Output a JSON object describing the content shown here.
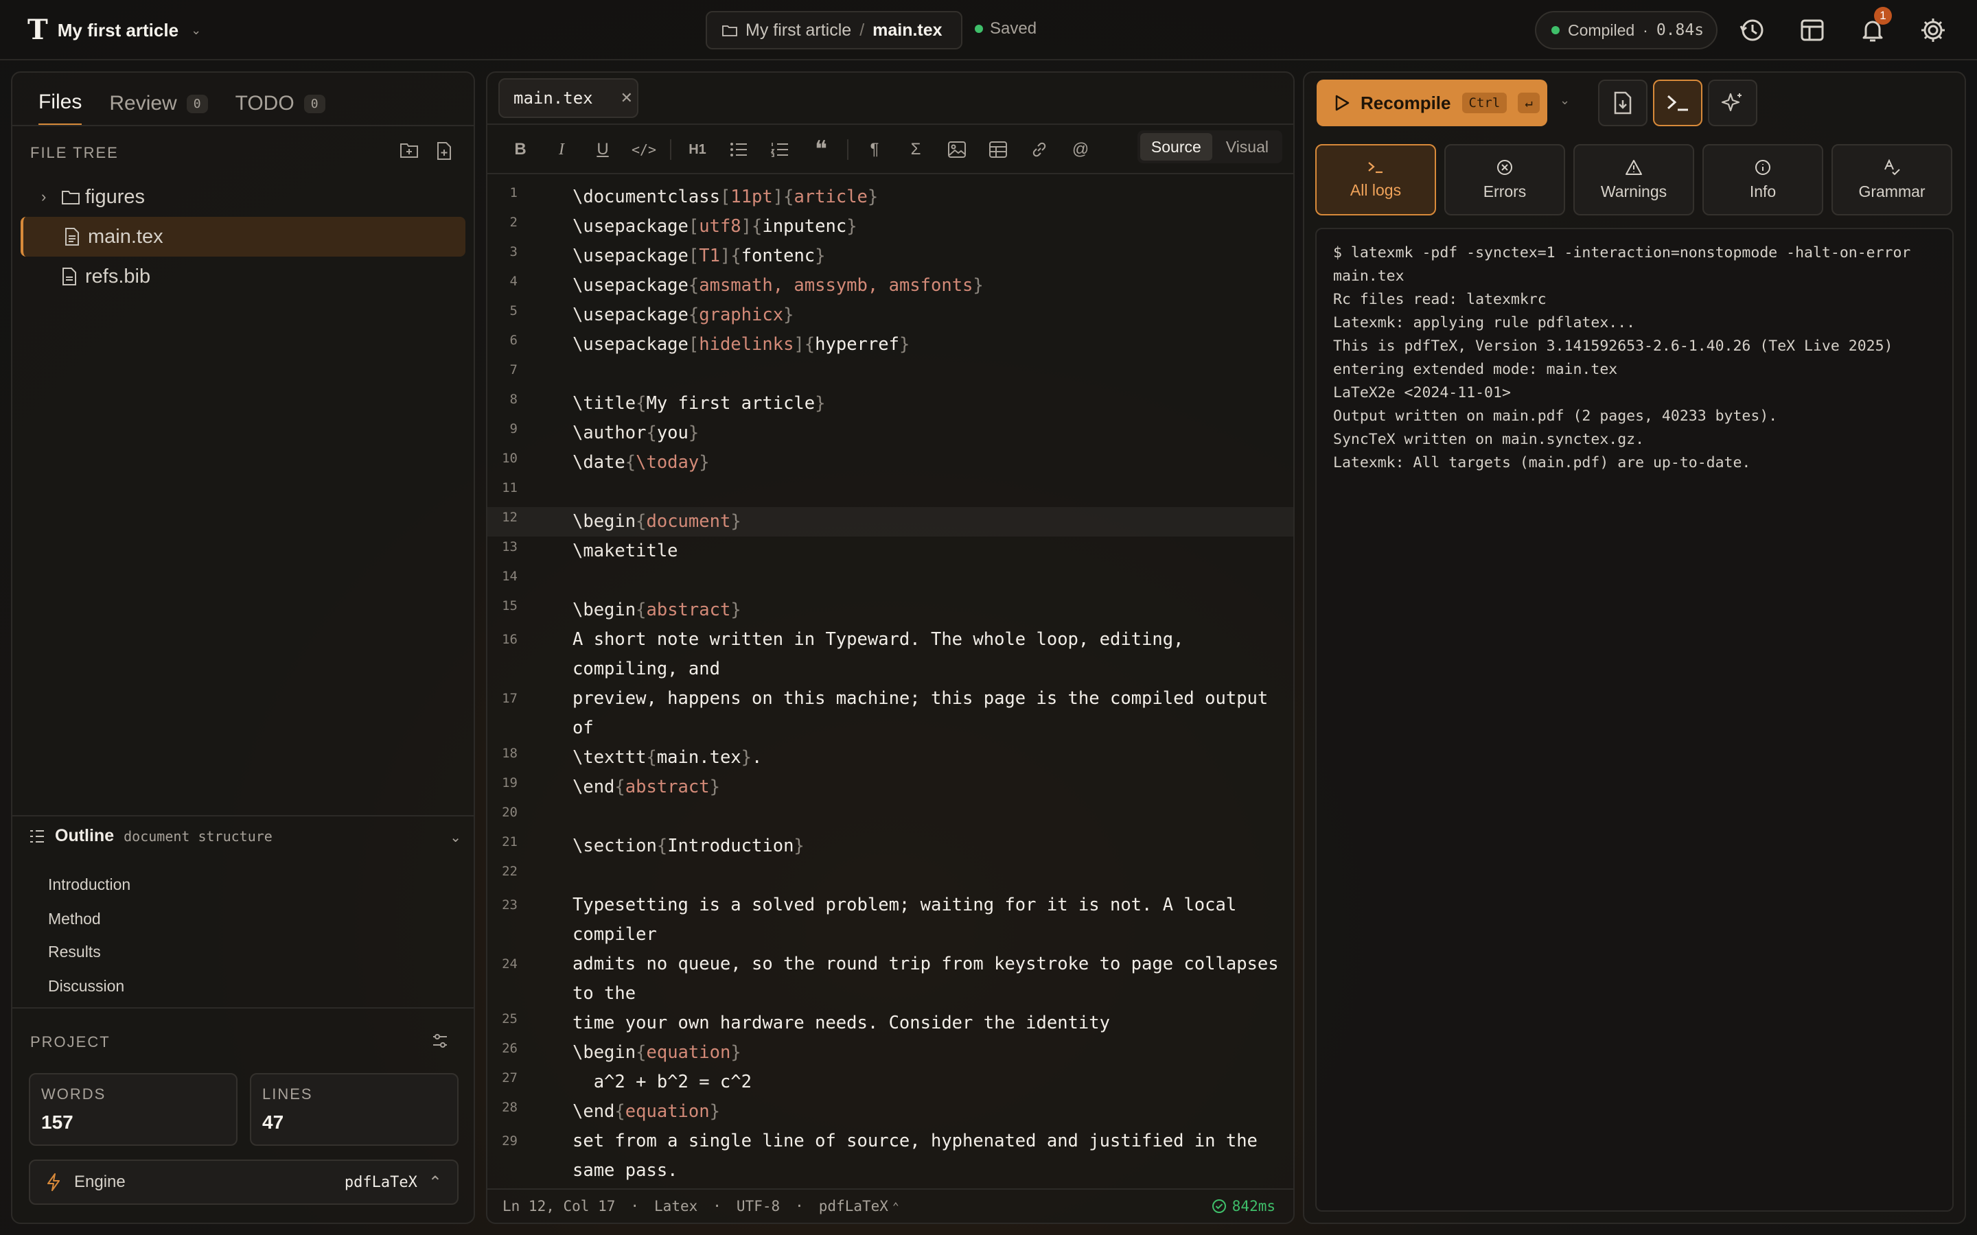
{
  "app": {
    "project_title": "My first article"
  },
  "breadcrumb": {
    "project": "My first article",
    "separator": "/",
    "file": "main.tex",
    "saved_label": "Saved"
  },
  "compile_status": {
    "label": "Compiled",
    "separator": "·",
    "time": "0.84s"
  },
  "notifications": {
    "count": "1"
  },
  "sidebar": {
    "tabs": [
      {
        "label": "Files",
        "count": ""
      },
      {
        "label": "Review",
        "count": "0"
      },
      {
        "label": "TODO",
        "count": "0"
      }
    ],
    "file_tree_label": "FILE TREE",
    "tree": [
      {
        "label": "figures",
        "type": "folder"
      },
      {
        "label": "main.tex",
        "type": "file",
        "selected": true
      },
      {
        "label": "refs.bib",
        "type": "file"
      }
    ],
    "outline": {
      "title": "Outline",
      "subtitle": "document structure",
      "items": [
        "Introduction",
        "Method",
        "Results",
        "Discussion"
      ]
    },
    "project": {
      "label": "PROJECT",
      "words_label": "WORDS",
      "words": "157",
      "lines_label": "LINES",
      "lines": "47",
      "engine_label": "Engine",
      "engine_value": "pdfLaTeX"
    }
  },
  "editor": {
    "tab_label": "main.tex",
    "mode_source": "Source",
    "mode_visual": "Visual",
    "heading_button": "H1",
    "lines": [
      {
        "n": "1",
        "text": "\\documentclass[11pt]{article}"
      },
      {
        "n": "2",
        "text": "\\usepackage[utf8]{inputenc}"
      },
      {
        "n": "3",
        "text": "\\usepackage[T1]{fontenc}"
      },
      {
        "n": "4",
        "text": "\\usepackage{amsmath, amssymb, amsfonts}"
      },
      {
        "n": "5",
        "text": "\\usepackage{graphicx}"
      },
      {
        "n": "6",
        "text": "\\usepackage[hidelinks]{hyperref}"
      },
      {
        "n": "7",
        "text": ""
      },
      {
        "n": "8",
        "text": "\\title{My first article}"
      },
      {
        "n": "9",
        "text": "\\author{you}"
      },
      {
        "n": "10",
        "text": "\\date{\\today}"
      },
      {
        "n": "11",
        "text": ""
      },
      {
        "n": "12",
        "text": "\\begin{document}"
      },
      {
        "n": "13",
        "text": "\\maketitle"
      },
      {
        "n": "14",
        "text": ""
      },
      {
        "n": "15",
        "text": "\\begin{abstract}"
      },
      {
        "n": "16",
        "text": "A short note written in Typeward. The whole loop, editing,\ncompiling, and"
      },
      {
        "n": "17",
        "text": "preview, happens on this machine; this page is the compiled output\nof"
      },
      {
        "n": "18",
        "text": "\\texttt{main.tex}."
      },
      {
        "n": "19",
        "text": "\\end{abstract}"
      },
      {
        "n": "20",
        "text": ""
      },
      {
        "n": "21",
        "text": "\\section{Introduction}"
      },
      {
        "n": "22",
        "text": ""
      },
      {
        "n": "23",
        "text": "Typesetting is a solved problem; waiting for it is not. A local\ncompiler"
      },
      {
        "n": "24",
        "text": "admits no queue, so the round trip from keystroke to page collapses\nto the"
      },
      {
        "n": "25",
        "text": "time your own hardware needs. Consider the identity"
      },
      {
        "n": "26",
        "text": "\\begin{equation}"
      },
      {
        "n": "27",
        "text": "  a^2 + b^2 = c^2"
      },
      {
        "n": "28",
        "text": "\\end{equation}"
      },
      {
        "n": "29",
        "text": "set from a single line of source, hyphenated and justified in the\nsame pass."
      }
    ],
    "status": {
      "position": "Ln 12, Col 17",
      "language": "Latex",
      "encoding": "UTF-8",
      "engine": "pdfLaTeX",
      "timing": "842ms"
    }
  },
  "output": {
    "recompile_label": "Recompile",
    "shortcut_key": "Ctrl",
    "shortcut_enter": "↵",
    "log_tabs": [
      "All logs",
      "Errors",
      "Warnings",
      "Info",
      "Grammar"
    ],
    "log_lines": [
      "$ latexmk -pdf -synctex=1 -interaction=nonstopmode -halt-on-error",
      "main.tex",
      "Rc files read: latexmkrc",
      "Latexmk: applying rule pdflatex...",
      "This is pdfTeX, Version 3.141592653-2.6-1.40.26 (TeX Live 2025)",
      "entering extended mode: main.tex",
      "LaTeX2e <2024-11-01>",
      "Output written on main.pdf (2 pages, 40233 bytes).",
      "SyncTeX written on main.synctex.gz.",
      "Latexmk: All targets (main.pdf) are up-to-date."
    ]
  },
  "colors": {
    "accent": "#d8893a",
    "success": "#3fbf6a",
    "latex_arg": "#d38a78"
  }
}
